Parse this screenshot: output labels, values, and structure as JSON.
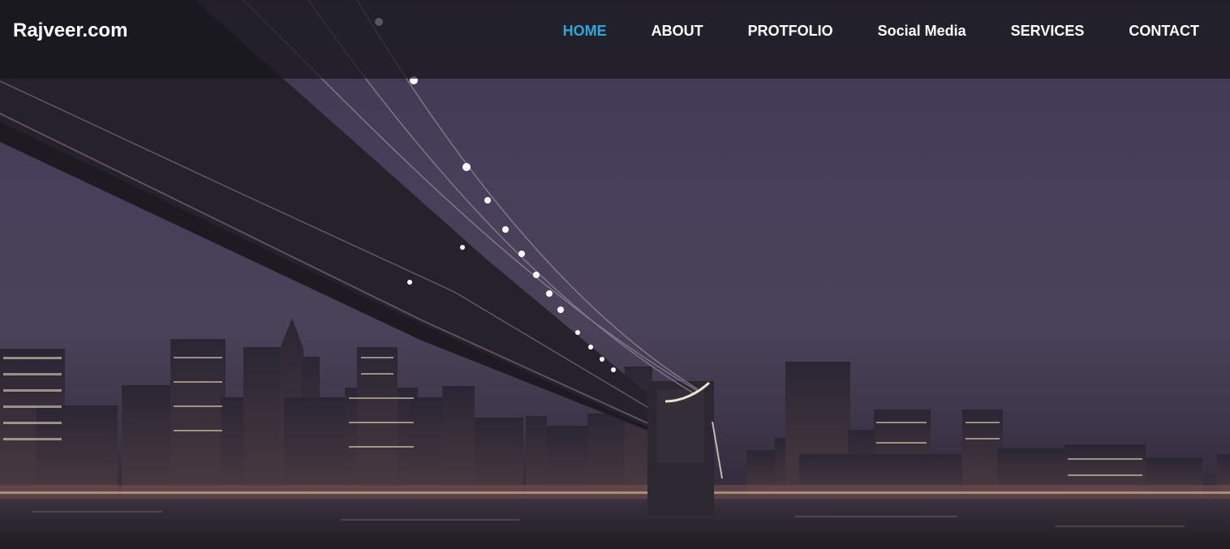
{
  "brand": {
    "name": "Rajveer.com"
  },
  "nav": {
    "items": [
      {
        "label": "HOME",
        "active": true
      },
      {
        "label": "ABOUT",
        "active": false
      },
      {
        "label": "PROTFOLIO",
        "active": false
      },
      {
        "label": "Social Media",
        "active": false
      },
      {
        "label": "SERVICES",
        "active": false
      },
      {
        "label": "CONTACT",
        "active": false
      }
    ]
  },
  "colors": {
    "accent": "#2aa9d8",
    "nav_text": "#ffffff",
    "navbar_bg": "#18161c"
  },
  "hero": {
    "image_subject": "night-city-skyline-with-suspension-bridge"
  }
}
